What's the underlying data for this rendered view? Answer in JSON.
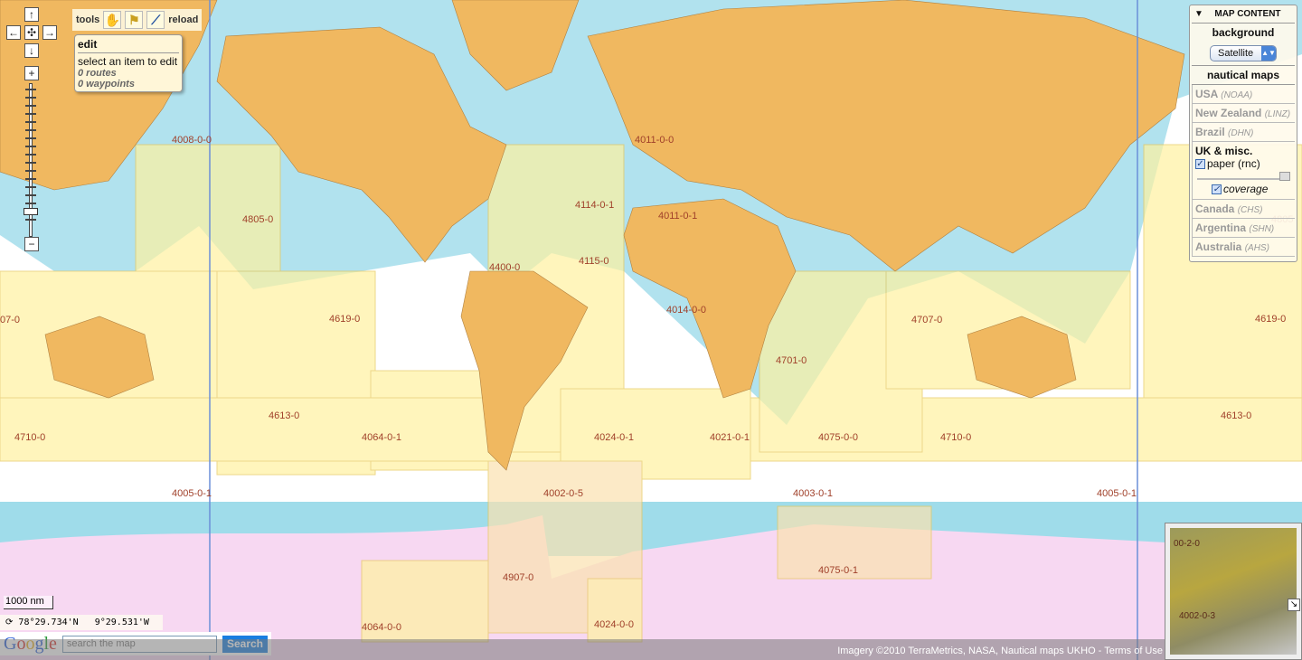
{
  "colors": {
    "ocean": "#ffffff",
    "shallow": "#9fdcea",
    "land": "#f0b860",
    "chart_fill": "#fff2a0",
    "antarctica": "#f7d8f2",
    "label": "#a0402a"
  },
  "map_controls": {
    "pan_up": "↑",
    "pan_left": "←",
    "pan_center": "✣",
    "pan_right": "→",
    "pan_down": "↓",
    "zoom_in": "+",
    "zoom_out": "−"
  },
  "tools": {
    "label": "tools",
    "hand_icon": "hand-icon",
    "flag_icon": "flag-icon",
    "route_icon": "route-icon",
    "reload": "reload"
  },
  "edit_box": {
    "title": "edit",
    "hint": "select an item to edit",
    "routes": "0 routes",
    "waypoints": "0 waypoints"
  },
  "panel": {
    "title": "MAP CONTENT",
    "collapse": "▼",
    "background_label": "background",
    "background_value": "Satellite",
    "nautical_label": "nautical maps",
    "sources": [
      {
        "name": "USA",
        "agency": "(NOAA)"
      },
      {
        "name": "New Zealand",
        "agency": "(LINZ)"
      },
      {
        "name": "Brazil",
        "agency": "(DHN)"
      }
    ],
    "uk": {
      "name": "UK & misc.",
      "paper": "paper (rnc)",
      "paper_checked": true,
      "opacity": 1.0,
      "coverage": "coverage",
      "coverage_checked": true
    },
    "sources2": [
      {
        "name": "Canada",
        "agency": "(CHS)"
      },
      {
        "name": "Argentina",
        "agency": "(SHN)"
      },
      {
        "name": "Australia",
        "agency": "(AHS)"
      }
    ]
  },
  "chart_labels": [
    "4008-0-0",
    "4011-0-0",
    "4805-0",
    "4114-0-1",
    "4011-0-1",
    "4805",
    "4400-0",
    "4115-0",
    "4014-0-0",
    "4619-0",
    "4707-0",
    "4619-0",
    "07-0",
    "4701-0",
    "4613-0",
    "4613-0",
    "4710-0",
    "4064-0-1",
    "4024-0-1",
    "4021-0-1",
    "4075-0-0",
    "4710-0",
    "4005-0-1",
    "4002-0-5",
    "4003-0-1",
    "4005-0-1",
    "4907-0",
    "4075-0-1",
    "4064-0-0",
    "4024-0-0"
  ],
  "scale": "1000 nm",
  "coords": {
    "lat": "78°29.734'N",
    "lon": "9°29.531'W"
  },
  "search": {
    "logo": "Google",
    "placeholder": "search the map",
    "button": "Search"
  },
  "attribution": "Imagery ©2010 TerraMetrics, NASA, Nautical maps UKHO - Terms of Use",
  "overview": {
    "labels": [
      "00-2-0",
      "4002-0-3"
    ],
    "toggle": "↘"
  }
}
